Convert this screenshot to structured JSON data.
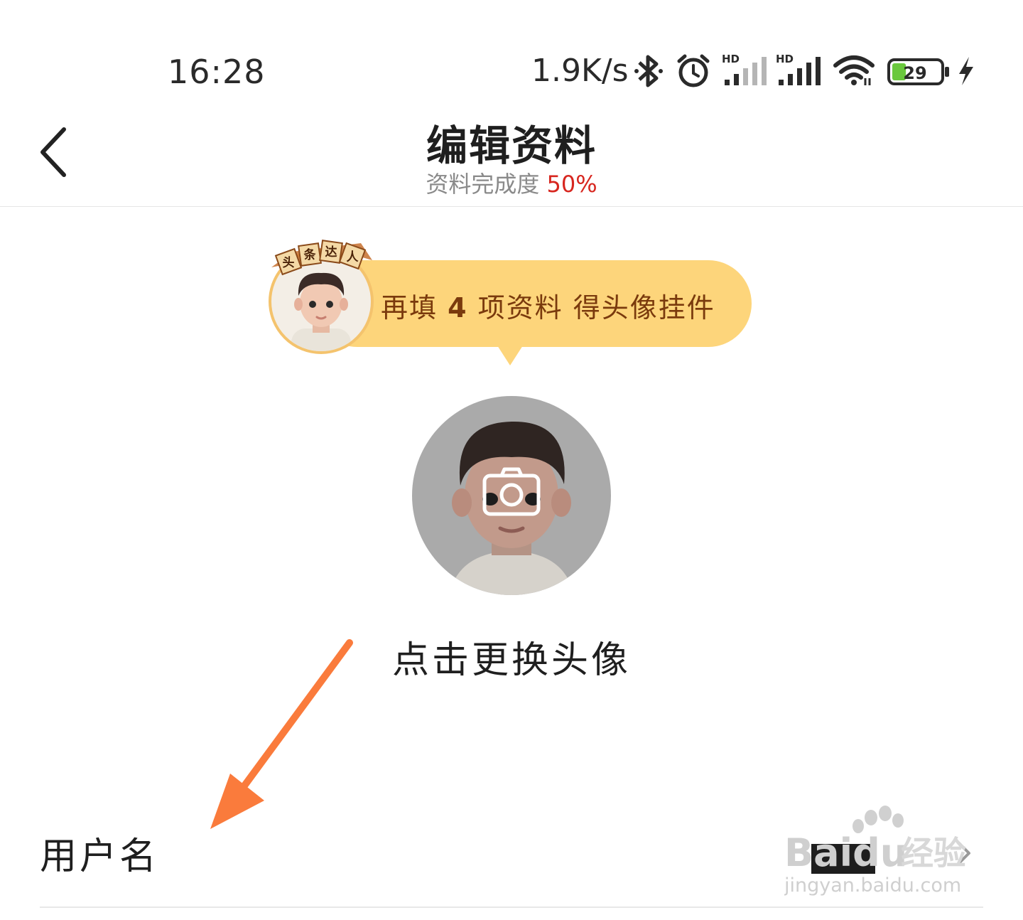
{
  "status_bar": {
    "time": "16:28",
    "net_speed": "1.9K/s",
    "hd_label": "HD",
    "battery_level": "29",
    "battery_fraction": 0.29,
    "icons": [
      "bluetooth-icon",
      "alarm-icon",
      "signal-hd-icon",
      "signal-hd-icon",
      "wifi-icon",
      "battery-icon",
      "charging-icon"
    ]
  },
  "header": {
    "title": "编辑资料",
    "completion_label": "资料完成度",
    "completion_percent": "50%",
    "completion_fraction": 0.5
  },
  "promo": {
    "prefix": "再填 ",
    "count": "4",
    "suffix": " 项资料 得头像挂件",
    "badge_chars": [
      "头",
      "条",
      "达",
      "人"
    ]
  },
  "avatar": {
    "change_label": "点击更换头像"
  },
  "fields": {
    "username_label": "用户名"
  },
  "watermark": {
    "brand": "Baidu",
    "cn": "经验",
    "url": "jingyan.baidu.com"
  },
  "colors": {
    "accent_red": "#d7261f",
    "promo_bg": "#fdd57b",
    "promo_text": "#7a3a0d",
    "annotation_arrow": "#fa7b3c",
    "battery_green": "#6ac83d"
  }
}
